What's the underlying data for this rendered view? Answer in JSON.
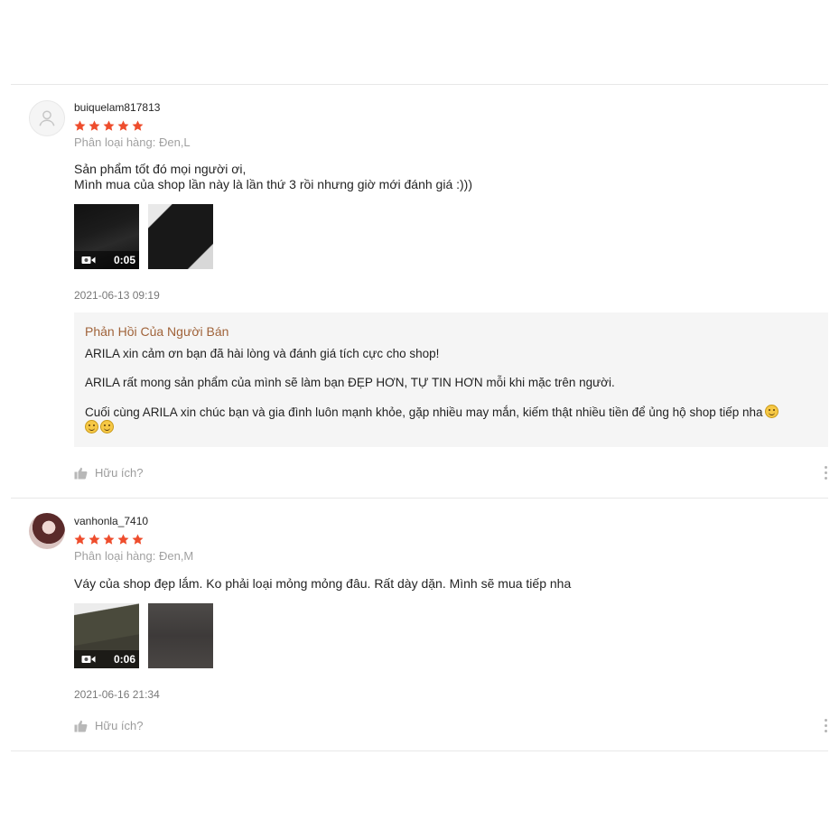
{
  "reviews": [
    {
      "username": "buiquelam817813",
      "rating": 5,
      "variation": "Phân loại hàng: Đen,L",
      "content": "Sản phẩm tốt đó mọi người ơi,\nMình mua  của shop lần này là lần thứ 3 rồi nhưng giờ mới đánh giá :)))",
      "video_duration": "0:05",
      "time": "2021-06-13 09:19",
      "seller_reply": {
        "title": "Phản Hồi Của Người Bán",
        "line1": "ARILA xin cảm ơn bạn đã hài lòng và đánh giá tích cực cho shop!",
        "line2": "ARILA rất mong sản phẩm của mình sẽ làm bạn ĐẸP HƠN, TỰ TIN HƠN mỗi khi mặc trên người.",
        "line3": "Cuối cùng ARILA xin chúc bạn và gia đình luôn mạnh khỏe, gặp nhiều may mắn, kiếm thật nhiều tiền để ủng hộ shop tiếp nha"
      },
      "helpful_label": "Hữu ích?"
    },
    {
      "username": "vanhonla_7410",
      "rating": 5,
      "variation": "Phân loại hàng: Đen,M",
      "content": "Váy của shop đẹp lắm. Ko phải loại mỏng mỏng đâu. Rất dày dặn. Mình sẽ mua tiếp nha",
      "video_duration": "0:06",
      "time": "2021-06-16 21:34",
      "helpful_label": "Hữu ích?"
    }
  ],
  "colors": {
    "star": "#ee4d2d",
    "reply_title": "#a0633a",
    "reply_bg": "#f5f5f5"
  },
  "icons": {
    "star": "star-icon",
    "video": "video-camera-icon",
    "like": "thumbs-up-icon",
    "more": "more-vertical-icon",
    "avatar_default": "user-icon"
  }
}
